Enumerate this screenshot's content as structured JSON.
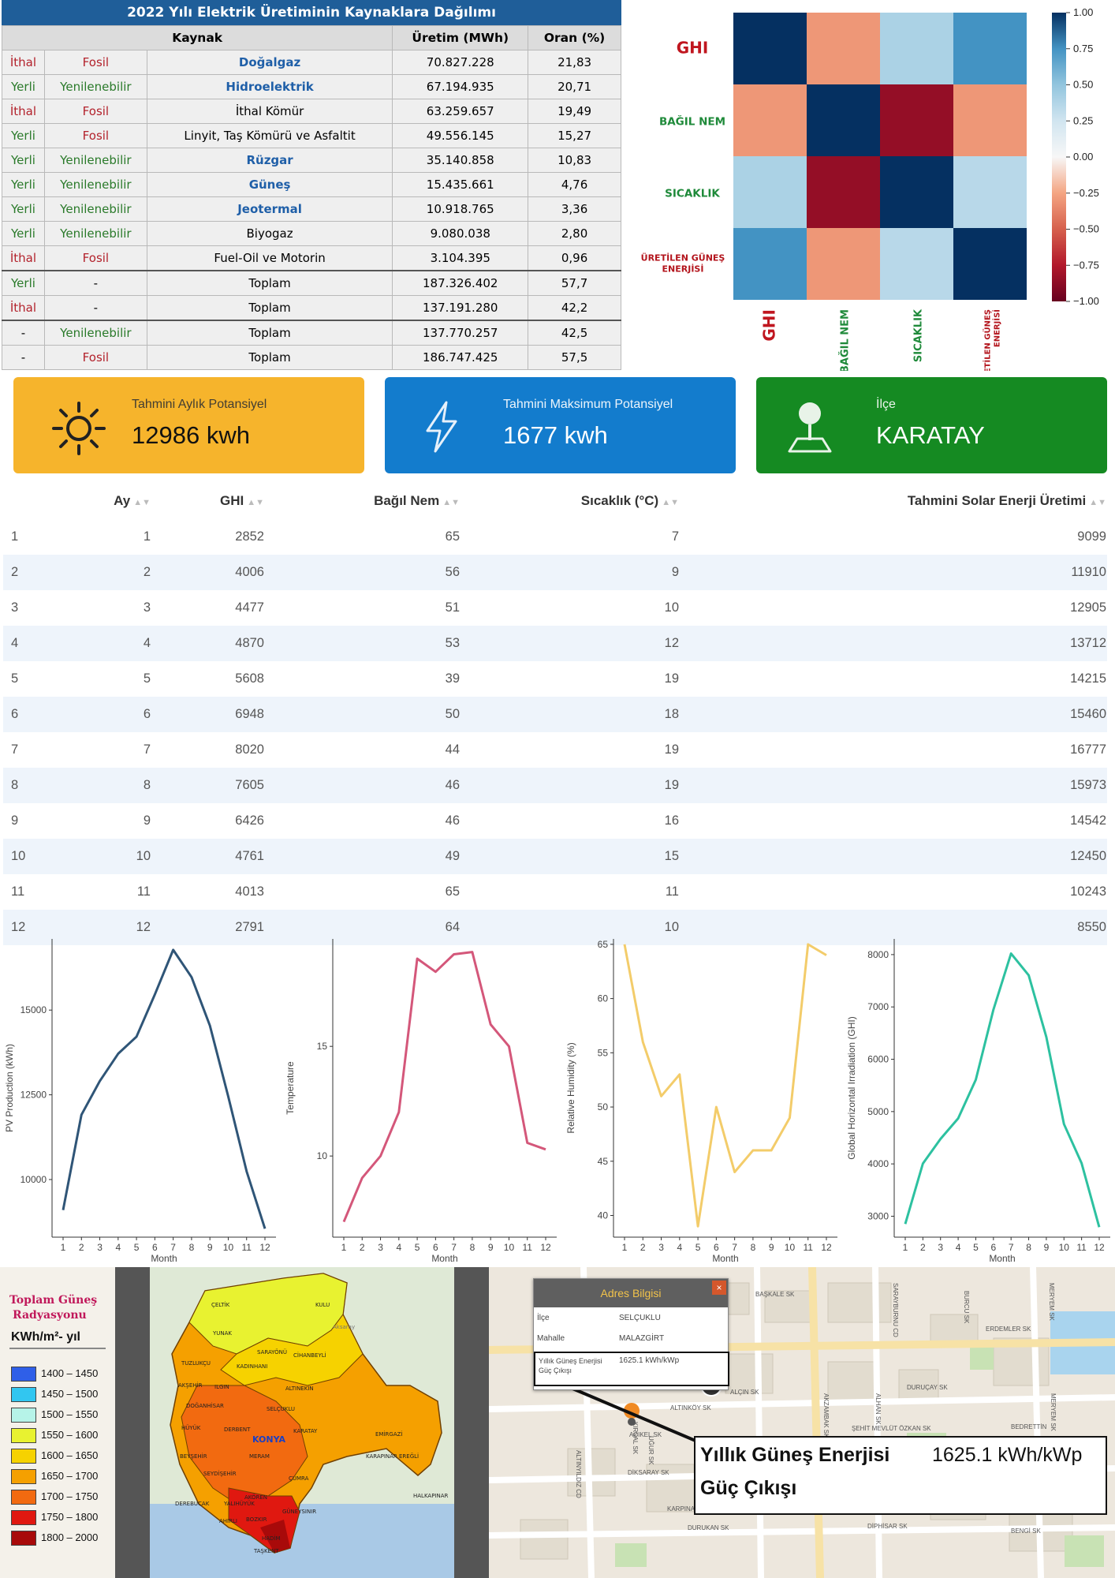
{
  "energy_table": {
    "title": "2022 Yılı Elektrik Üretiminin Kaynaklara Dağılımı",
    "headers": {
      "source": "Kaynak",
      "production": "Üretim (MWh)",
      "ratio": "Oran (%)"
    },
    "rows": [
      {
        "origin": "İthal",
        "type": "Fosil",
        "name": "Doğalgaz",
        "production": "70.827.228",
        "ratio": "21,83"
      },
      {
        "origin": "Yerli",
        "type": "Yenilenebilir",
        "name": "Hidroelektrik",
        "production": "67.194.935",
        "ratio": "20,71"
      },
      {
        "origin": "İthal",
        "type": "Fosil",
        "name": "İthal Kömür",
        "production": "63.259.657",
        "ratio": "19,49"
      },
      {
        "origin": "Yerli",
        "type": "Fosil",
        "name": "Linyit, Taş Kömürü ve Asfaltit",
        "production": "49.556.145",
        "ratio": "15,27"
      },
      {
        "origin": "Yerli",
        "type": "Yenilenebilir",
        "name": "Rüzgar",
        "production": "35.140.858",
        "ratio": "10,83"
      },
      {
        "origin": "Yerli",
        "type": "Yenilenebilir",
        "name": "Güneş",
        "production": "15.435.661",
        "ratio": "4,76"
      },
      {
        "origin": "Yerli",
        "type": "Yenilenebilir",
        "name": "Jeotermal",
        "production": "10.918.765",
        "ratio": "3,36"
      },
      {
        "origin": "Yerli",
        "type": "Yenilenebilir",
        "name": "Biyogaz",
        "production": "9.080.038",
        "ratio": "2,80"
      },
      {
        "origin": "İthal",
        "type": "Fosil",
        "name": "Fuel-Oil ve Motorin",
        "production": "3.104.395",
        "ratio": "0,96"
      },
      {
        "origin": "Yerli",
        "type": "-",
        "name": "Toplam",
        "production": "187.326.402",
        "ratio": "57,7"
      },
      {
        "origin": "İthal",
        "type": "-",
        "name": "Toplam",
        "production": "137.191.280",
        "ratio": "42,2"
      },
      {
        "origin": "-",
        "type": "Yenilenebilir",
        "name": "Toplam",
        "production": "137.770.257",
        "ratio": "42,5"
      },
      {
        "origin": "-",
        "type": "Fosil",
        "name": "Toplam",
        "production": "186.747.425",
        "ratio": "57,5"
      }
    ]
  },
  "heatmap": {
    "row_labels": [
      "GHI",
      "BAĞIL NEM",
      "SICAKLIK",
      "ÜRETİLEN GÜNEŞ ENERJİSİ"
    ],
    "col_labels": [
      "GHI",
      "BAĞIL NEM",
      "SICAKLIK",
      "ÜRETİLEN GÜNEŞ ENERJİSİ"
    ],
    "colorbar_ticks": [
      "1.00",
      "0.75",
      "0.50",
      "0.25",
      "0.00",
      "−0.25",
      "−0.50",
      "−0.75",
      "−1.00"
    ],
    "values": [
      [
        1.0,
        -0.3,
        0.4,
        0.75
      ],
      [
        -0.3,
        1.0,
        -0.85,
        -0.3
      ],
      [
        0.4,
        -0.85,
        1.0,
        0.35
      ],
      [
        0.75,
        -0.3,
        0.35,
        1.0
      ]
    ]
  },
  "cards": {
    "monthly": {
      "label": "Tahmini Aylık Potansiyel",
      "value": "12986 kwh",
      "color": "#f6b42c",
      "icon": "sun-icon"
    },
    "max": {
      "label": "Tahmini Maksimum Potansiyel",
      "value": "1677 kwh",
      "color": "#137ccd",
      "icon": "lightning-icon"
    },
    "district": {
      "label": "İlçe",
      "value": "KARATAY",
      "color": "#158a22",
      "icon": "map-pin-icon"
    }
  },
  "monthly_table": {
    "headers": [
      "Ay",
      "GHI",
      "Bağıl Nem",
      "Sıcaklık (°C)",
      "Tahmini Solar Enerji Üretimi"
    ],
    "rows": [
      [
        "1",
        "1",
        "2852",
        "65",
        "7",
        "9099"
      ],
      [
        "2",
        "2",
        "4006",
        "56",
        "9",
        "11910"
      ],
      [
        "3",
        "3",
        "4477",
        "51",
        "10",
        "12905"
      ],
      [
        "4",
        "4",
        "4870",
        "53",
        "12",
        "13712"
      ],
      [
        "5",
        "5",
        "5608",
        "39",
        "19",
        "14215"
      ],
      [
        "6",
        "6",
        "6948",
        "50",
        "18",
        "15460"
      ],
      [
        "7",
        "7",
        "8020",
        "44",
        "19",
        "16777"
      ],
      [
        "8",
        "8",
        "7605",
        "46",
        "19",
        "15973"
      ],
      [
        "9",
        "9",
        "6426",
        "46",
        "16",
        "14542"
      ],
      [
        "10",
        "10",
        "4761",
        "49",
        "15",
        "12450"
      ],
      [
        "11",
        "11",
        "4013",
        "65",
        "11",
        "10243"
      ],
      [
        "12",
        "12",
        "2791",
        "64",
        "10",
        "8550"
      ]
    ]
  },
  "chart_data": [
    {
      "type": "line",
      "xlabel": "Month",
      "ylabel": "PV Production (kWh)",
      "x": [
        1,
        2,
        3,
        4,
        5,
        6,
        7,
        8,
        9,
        10,
        11,
        12
      ],
      "values": [
        9099,
        11910,
        12905,
        13712,
        14215,
        15460,
        16777,
        15973,
        14542,
        12450,
        10243,
        8550
      ],
      "ylim": [
        8300,
        17100
      ],
      "yticks": [
        10000,
        12500,
        15000
      ],
      "color": "#2f5577"
    },
    {
      "type": "line",
      "xlabel": "Month",
      "ylabel": "Temperature",
      "x": [
        1,
        2,
        3,
        4,
        5,
        6,
        7,
        8,
        9,
        10,
        11,
        12
      ],
      "values": [
        7,
        9,
        10,
        12,
        19,
        18.4,
        19.2,
        19.3,
        16,
        15,
        10.6,
        10.3
      ],
      "ylim": [
        6.3,
        19.9
      ],
      "yticks": [
        10,
        15
      ],
      "color": "#d4577a"
    },
    {
      "type": "line",
      "xlabel": "Month",
      "ylabel": "Relative Humidity (%)",
      "x": [
        1,
        2,
        3,
        4,
        5,
        6,
        7,
        8,
        9,
        10,
        11,
        12
      ],
      "values": [
        65,
        56,
        51,
        53,
        39,
        50,
        44,
        46,
        46,
        49,
        65,
        64
      ],
      "ylim": [
        38,
        65.5
      ],
      "yticks": [
        40,
        45,
        50,
        55,
        60,
        65
      ],
      "color": "#f3cc6a"
    },
    {
      "type": "line",
      "xlabel": "Month",
      "ylabel": "Global Horizontal Irradiation (GHI)",
      "x": [
        1,
        2,
        3,
        4,
        5,
        6,
        7,
        8,
        9,
        10,
        11,
        12
      ],
      "values": [
        2852,
        4006,
        4477,
        4870,
        5608,
        6948,
        8020,
        7605,
        6426,
        4761,
        4013,
        2791
      ],
      "ylim": [
        2600,
        8300
      ],
      "yticks": [
        3000,
        4000,
        5000,
        6000,
        7000,
        8000
      ],
      "color": "#2dc1a0"
    }
  ],
  "radiation_map": {
    "legend_title_1": "Toplam Güneş",
    "legend_title_2": "Radyasyonu",
    "legend_unit": "KWh/m²- yıl",
    "legend": [
      {
        "range": "1400 – 1450",
        "color": "#2f5fe8"
      },
      {
        "range": "1450 – 1500",
        "color": "#32c6f0"
      },
      {
        "range": "1500 – 1550",
        "color": "#b6f3e8"
      },
      {
        "range": "1550 – 1600",
        "color": "#e8f230"
      },
      {
        "range": "1600 – 1650",
        "color": "#f6d200"
      },
      {
        "range": "1650 – 1700",
        "color": "#f5a000"
      },
      {
        "range": "1700 – 1750",
        "color": "#f26a10"
      },
      {
        "range": "1750 – 1800",
        "color": "#e01810"
      },
      {
        "range": "1800 – 2000",
        "color": "#a80a0a"
      }
    ],
    "districts": [
      "ÇELTİK",
      "KULU",
      "YUNAK",
      "SARAYÖNÜ",
      "CİHANBEYLİ",
      "TUZLUKÇU",
      "KADINHANI",
      "AKŞEHİR",
      "ILGIN",
      "ALTINEKİN",
      "DOĞANHİSAR",
      "SELÇUKLU",
      "HÜYÜK",
      "DERBENT",
      "KONYA",
      "KARATAY",
      "EMİRGAZİ",
      "BEYŞEHİR",
      "MERAM",
      "EREĞLİ",
      "KARAPINAR",
      "SEYDİŞEHİR",
      "ÇUMRA",
      "DEREBUCAK",
      "YALIHÜYÜK",
      "AKÖREN",
      "HALKAPINAR",
      "AHIRLI",
      "BOZKIR",
      "GÜNEYSINIR",
      "HADİM",
      "TAŞKENT",
      "Aksaray"
    ]
  },
  "address_map": {
    "popup_title": "Adres Bilgisi",
    "rows": [
      {
        "key": "İlçe",
        "value": "SELÇUKLU"
      },
      {
        "key": "Mahalle",
        "value": "MALAZGİRT"
      },
      {
        "key": "Yıllık Güneş Enerjisi Güç Çıkışı",
        "value": "1625.1 kWh/kWp"
      }
    ],
    "callout_label_1": "Yıllık Güneş Enerjisi",
    "callout_label_2": "Güç Çıkışı",
    "callout_value": "1625.1 kWh/kWp",
    "streets": [
      "BAŞKALE SK",
      "SARAYBURNU CD",
      "BURCU SK",
      "MERYEM SK",
      "ERDEMLER SK",
      "ALÇIN SK",
      "ALTINKÖY SK",
      "AKZAMBAK SK",
      "ALHAN SK",
      "DURUÇAY SK",
      "ŞEHİT MEVLÜT ÖZKAN SK",
      "BEDRETTİN",
      "AÇIKEL SK",
      "DİKSARAY SK",
      "ALTINYILDIZ CD",
      "KARPINAR SK",
      "DURUKAN SK",
      "DİPHİSAR SK",
      "BENGİ SK",
      "UĞUR SK",
      "KIRSAL SK",
      "MERYEM SK"
    ]
  }
}
